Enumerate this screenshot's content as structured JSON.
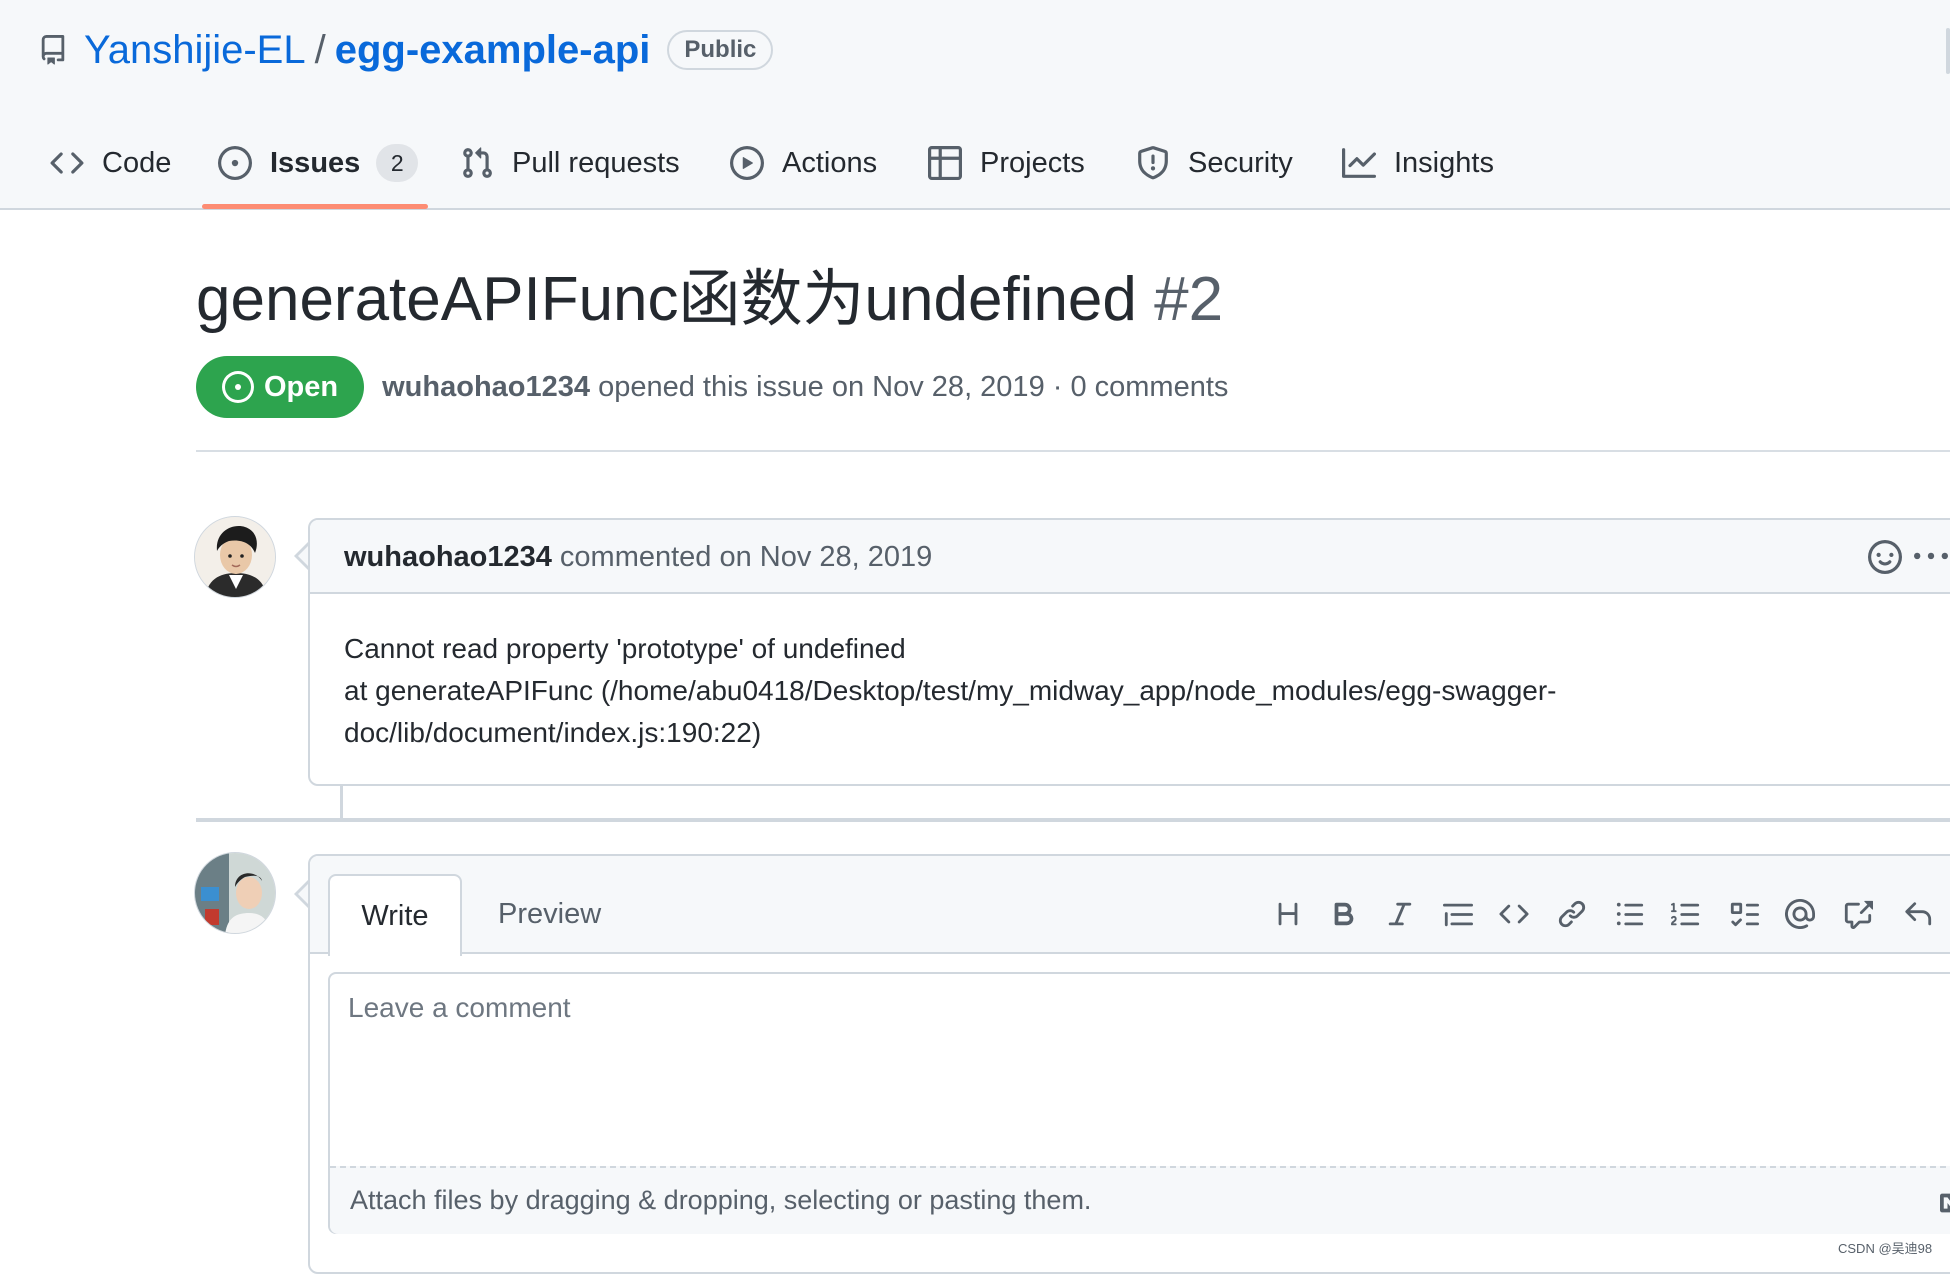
{
  "repo": {
    "owner": "Yanshijie-EL",
    "separator": "/",
    "name": "egg-example-api",
    "visibility": "Public"
  },
  "tabs": [
    {
      "label": "Code",
      "icon": "code-icon"
    },
    {
      "label": "Issues",
      "icon": "issue-opened-icon",
      "count": "2",
      "active": true
    },
    {
      "label": "Pull requests",
      "icon": "git-pull-request-icon"
    },
    {
      "label": "Actions",
      "icon": "play-icon"
    },
    {
      "label": "Projects",
      "icon": "table-icon"
    },
    {
      "label": "Security",
      "icon": "shield-icon"
    },
    {
      "label": "Insights",
      "icon": "graph-icon"
    }
  ],
  "issue": {
    "title": "generateAPIFunc函数为undefined",
    "number": "#2",
    "state": "Open",
    "author": "wuhaohao1234",
    "meta_suffix": "opened this issue on Nov 28, 2019 · 0 comments"
  },
  "comment": {
    "author": "wuhaohao1234",
    "action": "commented on Nov 28, 2019",
    "body_lines": [
      "Cannot read property 'prototype' of undefined",
      "at generateAPIFunc (/home/abu0418/Desktop/test/my_midway_app/node_modules/egg-swagger-",
      "doc/lib/document/index.js:190:22)"
    ]
  },
  "editor": {
    "write_tab": "Write",
    "preview_tab": "Preview",
    "placeholder": "Leave a comment",
    "attach_text": "Attach files by dragging & dropping, selecting or pasting them.",
    "tools": [
      "heading-icon",
      "bold-icon",
      "italic-icon",
      "quote-icon",
      "code-icon",
      "link-icon",
      "list-unordered-icon",
      "list-ordered-icon",
      "tasklist-icon",
      "mention-icon",
      "cross-reference-icon",
      "reply-icon"
    ]
  },
  "watermark": "CSDN @吴迪98",
  "colors": {
    "link": "#0969da",
    "open_green": "#2da44e",
    "tab_underline": "#fd8c73",
    "border": "#d0d7de",
    "muted": "#57606a"
  }
}
